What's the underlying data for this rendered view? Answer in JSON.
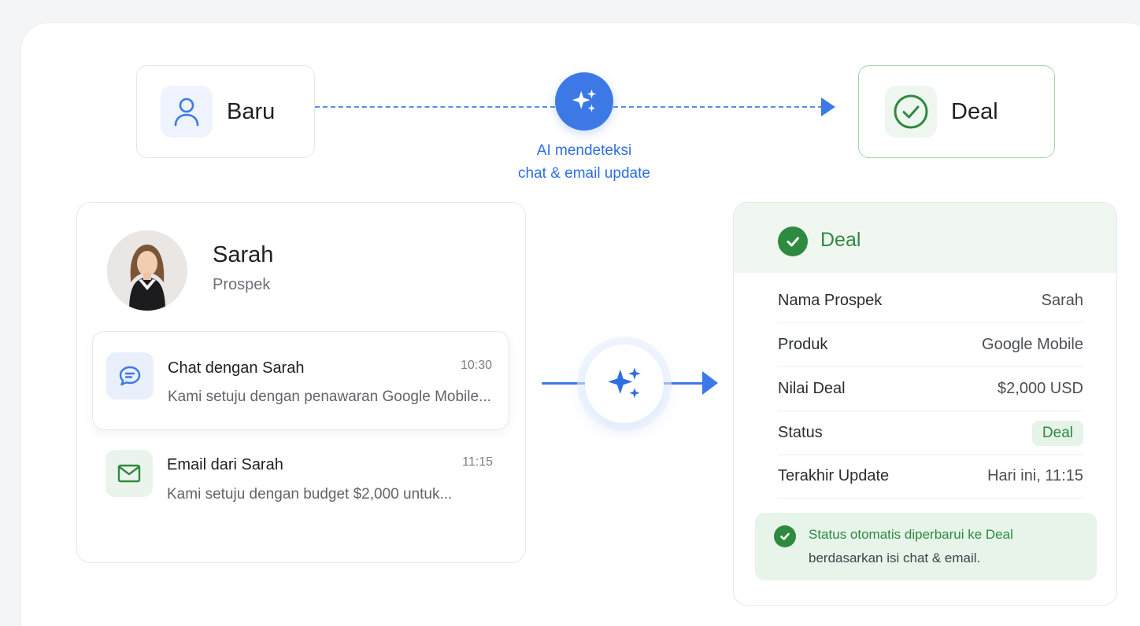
{
  "stages": {
    "from": {
      "label": "Baru",
      "icon": "user-icon"
    },
    "to": {
      "label": "Deal",
      "icon": "check-circle-icon"
    }
  },
  "ai": {
    "icon": "sparkle-icon",
    "caption_line1": "AI mendeteksi",
    "caption_line2": "chat & email update"
  },
  "contact": {
    "name": "Sarah",
    "role": "Prospek",
    "avatar_icon": "avatar-photo"
  },
  "messages": [
    {
      "icon": "chat-bubble-icon",
      "title": "Chat dengan Sarah",
      "time": "10:30",
      "preview": "Kami setuju dengan penawaran Google Mobile..."
    },
    {
      "icon": "mail-icon",
      "title": "Email dari Sarah",
      "time": "11:15",
      "preview": "Kami setuju dengan budget $2,000 untuk..."
    }
  ],
  "deal": {
    "title": "Deal",
    "rows": [
      {
        "label": "Nama Prospek",
        "value": "Sarah"
      },
      {
        "label": "Produk",
        "value": "Google Mobile"
      },
      {
        "label": "Nilai Deal",
        "value": "$2,000 USD"
      },
      {
        "label": "Status",
        "value": "Deal"
      },
      {
        "label": "Terakhir Update",
        "value": "Hari ini, 11:15"
      }
    ],
    "note_line1": "Status otomatis diperbarui ke Deal",
    "note_line2": "berdasarkan isi chat & email."
  },
  "colors": {
    "accent_blue": "#3d79e6",
    "accent_green": "#2e8a3f",
    "green_bg": "#e6f4e9"
  }
}
